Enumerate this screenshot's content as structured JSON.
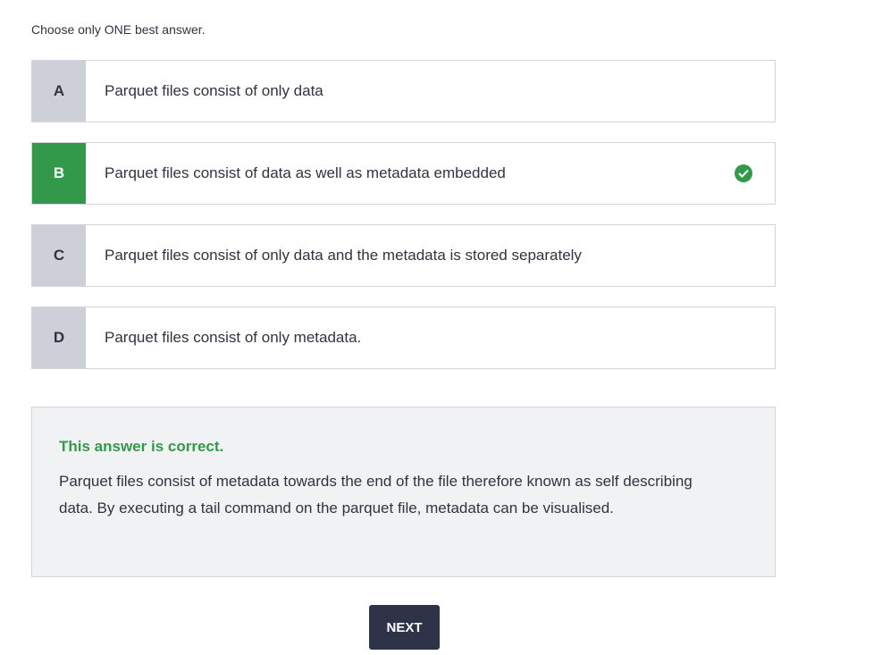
{
  "instruction": "Choose only ONE best answer.",
  "options": [
    {
      "letter": "A",
      "text": "Parquet files consist of only data"
    },
    {
      "letter": "B",
      "text": "Parquet files consist of data as well as metadata embedded",
      "correct": true
    },
    {
      "letter": "C",
      "text": "Parquet files consist of only data and the metadata is stored separately"
    },
    {
      "letter": "D",
      "text": "Parquet files consist of only metadata."
    }
  ],
  "feedback": {
    "title": "This answer is correct.",
    "body": "Parquet files consist of metadata towards the end of the file therefore known as self describing data. By executing a tail command on the parquet file, metadata can be visualised."
  },
  "next_label": "NEXT",
  "colors": {
    "correct": "#33994a",
    "button": "#2f3347"
  },
  "icons": {
    "correct": "check-circle-icon"
  }
}
